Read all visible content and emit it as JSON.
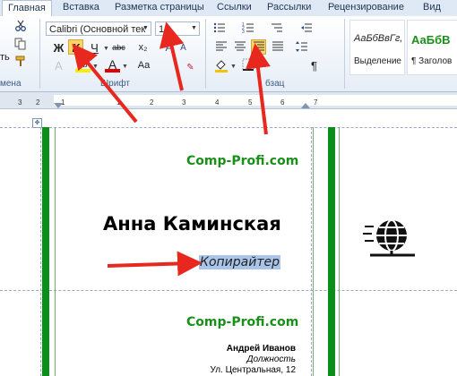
{
  "tabs": [
    {
      "label": "Главная",
      "active": true
    },
    {
      "label": "Вставка",
      "active": false
    },
    {
      "label": "Разметка страницы",
      "active": false
    },
    {
      "label": "Ссылки",
      "active": false
    },
    {
      "label": "Рассылки",
      "active": false
    },
    {
      "label": "Рецензирование",
      "active": false
    },
    {
      "label": "Вид",
      "active": false
    }
  ],
  "ribbon": {
    "clipboard_label": "мена",
    "font_name": "Calibri (Основной тек",
    "font_size": "16",
    "font_group_label": "Шрифт",
    "paragraph_group_label": "бзац",
    "paste_partial": "ть",
    "bold": "Ж",
    "italic": "К",
    "underline": "Ч",
    "strike": "abc",
    "subscript": "x₂",
    "highlight": "ab",
    "font_color": "A",
    "grow": "A",
    "shrink": "A",
    "change_case": "Aa",
    "pilcrow": "¶",
    "styles": [
      {
        "sample": "АаБбВвГг,",
        "name": "Выделение",
        "color": "#222222"
      },
      {
        "sample": "АаБбВ",
        "name": "¶ Заголов",
        "color": "#1a8f1a"
      }
    ],
    "style_partial_name": "З"
  },
  "ruler": {
    "ticks": [
      "3",
      "2",
      "1",
      "1",
      "2",
      "3",
      "4",
      "5",
      "6",
      "7"
    ]
  },
  "document": {
    "card1": {
      "site": "Comp-Profi.com",
      "name": "Анна Каминская",
      "role": "Копирайтер"
    },
    "card2": {
      "site": "Comp-Profi.com",
      "name": "Андрей Иванов",
      "role": "Должность",
      "address": "Ул. Центральная, 12"
    }
  },
  "colors": {
    "accent_green": "#0a8f1a",
    "arrow_red": "#e8271f",
    "highlight": "#a9c6ea",
    "active_button": "#fbd56a"
  },
  "icons": {
    "globe": "globe-icon",
    "scissors": "scissors-icon",
    "brush": "format-painter-icon"
  }
}
